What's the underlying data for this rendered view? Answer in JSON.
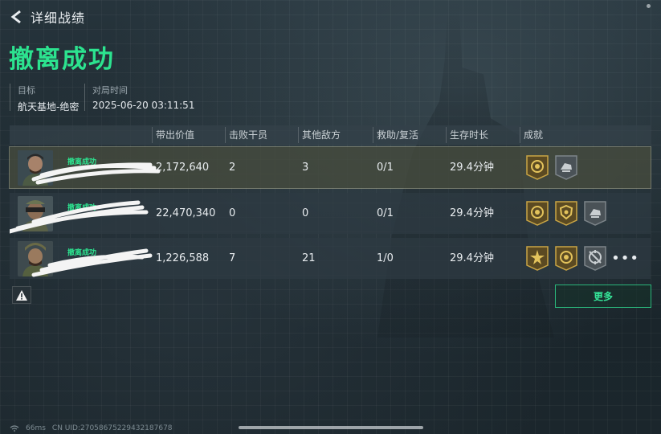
{
  "header": {
    "title": "详细战绩"
  },
  "result": {
    "title": "撤离成功"
  },
  "meta": {
    "target_label": "目标",
    "target_value": "航天基地-绝密",
    "time_label": "对局时间",
    "time_value": "2025-06-20 03:11:51"
  },
  "table": {
    "columns": [
      "带出价值",
      "击败干员",
      "其他敌方",
      "救助/复活",
      "生存时长",
      "成就"
    ],
    "rows": [
      {
        "status": "撤离成功",
        "value": "2,172,640",
        "kills": "2",
        "other": "3",
        "assist": "0/1",
        "time": "29.4分钟",
        "medals": [
          "gold-emblem-icon",
          "gray-hand-icon"
        ],
        "highlight": true
      },
      {
        "status": "撤离成功",
        "value": "22,470,340",
        "kills": "0",
        "other": "0",
        "assist": "0/1",
        "time": "29.4分钟",
        "medals": [
          "gold-emblem-icon",
          "gold-shield-icon",
          "gray-hand-icon"
        ],
        "highlight": false
      },
      {
        "status": "撤离成功",
        "value": "1,226,588",
        "kills": "7",
        "other": "21",
        "assist": "1/0",
        "time": "29.4分钟",
        "medals": [
          "gold-burst-icon",
          "gold-emblem-icon",
          "gray-crosshair-icon"
        ],
        "highlight": false
      }
    ],
    "more_dots": "•••"
  },
  "buttons": {
    "more": "更多"
  },
  "footer": {
    "ping": "66ms",
    "uid": "CN UID:27058675229432187678"
  },
  "colors": {
    "accent": "#2ce38f",
    "gold": "#c9a545",
    "gray_medal": "#7c8489"
  }
}
